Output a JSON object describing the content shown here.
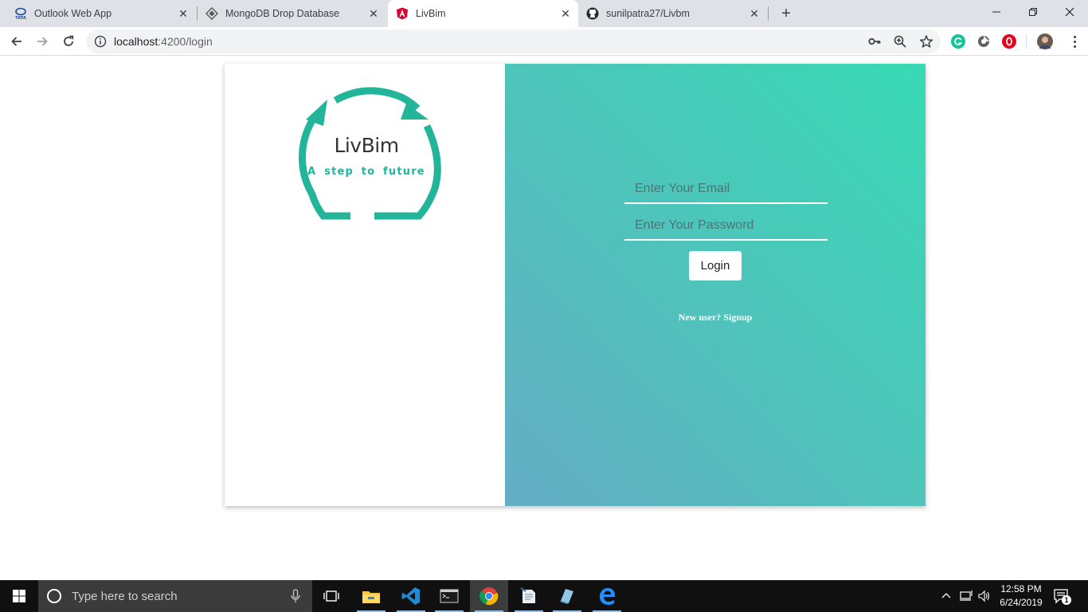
{
  "browser": {
    "tabs": [
      {
        "title": "Outlook Web App",
        "icon": "tata-icon"
      },
      {
        "title": "MongoDB Drop Database",
        "icon": "mongodb-icon"
      },
      {
        "title": "LivBim",
        "icon": "angular-icon"
      },
      {
        "title": "sunilpatra27/Livbm",
        "icon": "github-icon"
      }
    ],
    "url_host": "localhost",
    "url_rest": ":4200/login"
  },
  "logo": {
    "title": "LivBim",
    "tagline": "A  step to future",
    "color": "#22b59a"
  },
  "login_form": {
    "email_placeholder": "Enter Your Email",
    "password_placeholder": "Enter Your Password",
    "login_label": "Login",
    "signup_text": "New user? Signup"
  },
  "taskbar": {
    "search_placeholder": "Type here to search",
    "time": "12:58 PM",
    "date": "6/24/2019",
    "notification_count": "1"
  },
  "colors": {
    "gradient_top_right": "#38d9b4",
    "gradient_bottom_left": "#65adc4"
  }
}
